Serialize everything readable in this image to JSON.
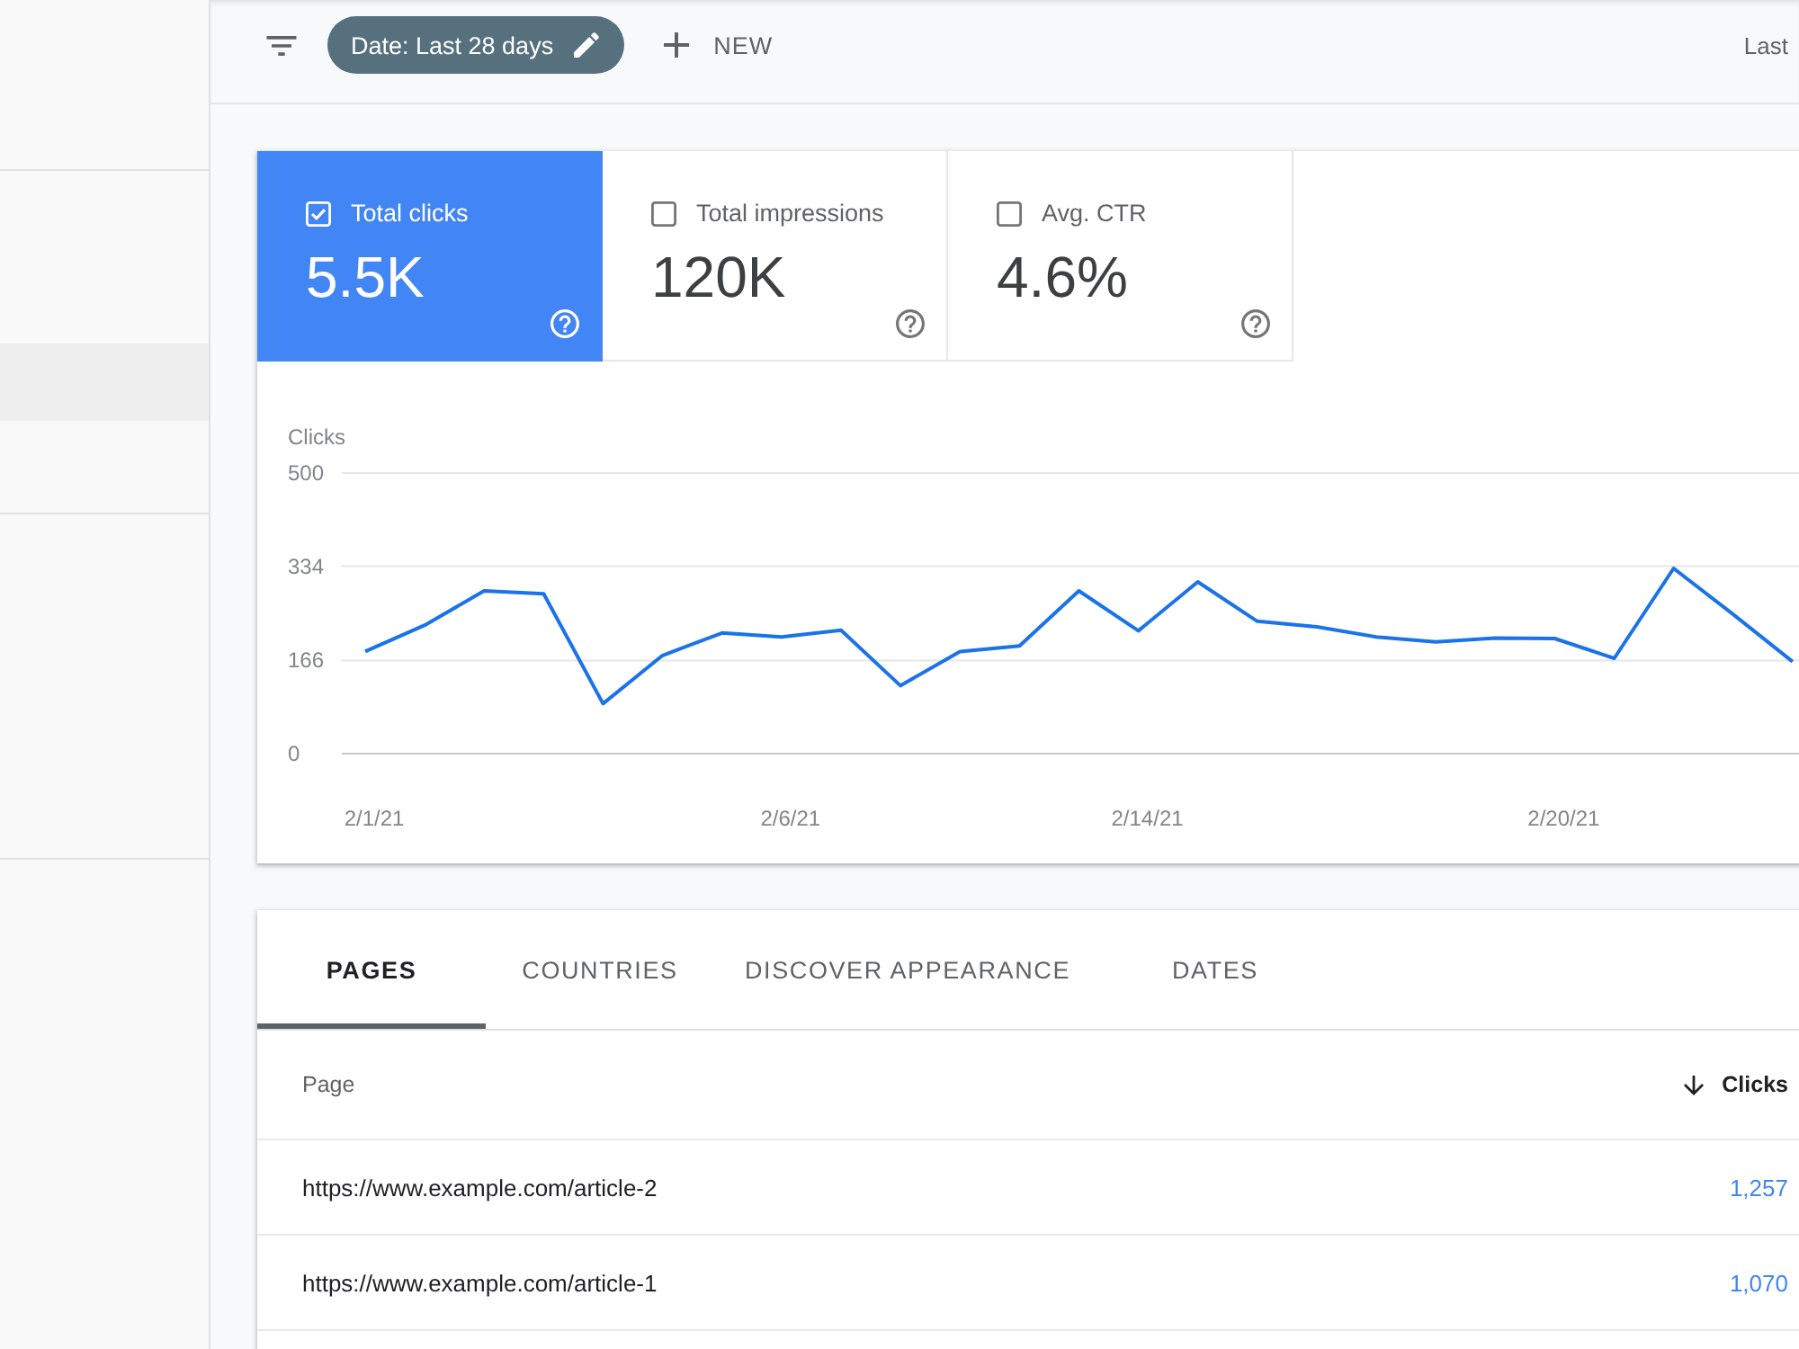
{
  "sidebar": {
    "items": [
      {
        "selected": true
      }
    ]
  },
  "toolbar": {
    "date_chip": "Date: Last 28 days",
    "new_button": "NEW",
    "right_text": "Last"
  },
  "metrics": [
    {
      "label": "Total clicks",
      "value": "5.5K",
      "checked": true
    },
    {
      "label": "Total impressions",
      "value": "120K",
      "checked": false
    },
    {
      "label": "Avg. CTR",
      "value": "4.6%",
      "checked": false
    }
  ],
  "chart": {
    "chart_data": {
      "type": "line",
      "ylabel": "Clicks",
      "categories": [
        "2/1/21",
        null,
        null,
        null,
        null,
        null,
        null,
        "2/6/21",
        null,
        null,
        null,
        null,
        null,
        "2/14/21",
        null,
        null,
        null,
        null,
        null,
        null,
        "2/20/21",
        null,
        null,
        null,
        null
      ],
      "series": [
        {
          "color": "#1a73e8",
          "values": [
            182,
            229,
            290,
            285,
            89,
            175,
            215,
            208,
            220,
            121,
            182,
            192,
            290,
            219,
            306,
            236,
            226,
            208,
            199,
            206,
            205,
            170,
            330,
            248,
            164
          ]
        }
      ],
      "ylim": [
        0,
        500
      ],
      "yticks": [
        0,
        166,
        334,
        500
      ]
    }
  },
  "tabs": [
    {
      "label": "PAGES",
      "selected": true
    },
    {
      "label": "COUNTRIES",
      "selected": false
    },
    {
      "label": "DISCOVER APPEARANCE",
      "selected": false
    },
    {
      "label": "DATES",
      "selected": false
    }
  ],
  "table": {
    "columns": [
      {
        "label": "Page",
        "sorted": false
      },
      {
        "label": "Clicks",
        "sorted": true
      }
    ],
    "rows": [
      {
        "page": "https://www.example.com/article-2",
        "clicks": "1,257"
      },
      {
        "page": "https://www.example.com/article-1",
        "clicks": "1,070"
      }
    ]
  }
}
